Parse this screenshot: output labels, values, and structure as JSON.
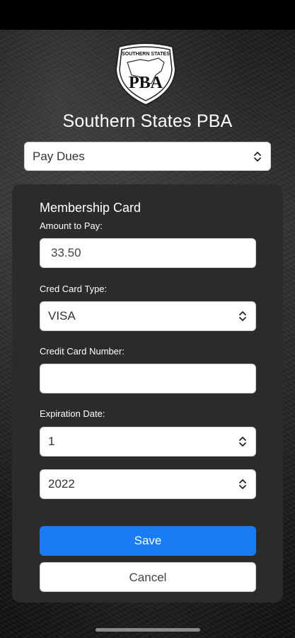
{
  "app": {
    "title": "Southern States PBA",
    "logo_top_text": "SOUTHERN STATES",
    "logo_letters": "PBA"
  },
  "nav_select": {
    "value": "Pay Dues"
  },
  "form": {
    "title": "Membership Card",
    "amount_label": "Amount to Pay:",
    "amount_value": "33.50",
    "card_type_label": "Cred Card Type:",
    "card_type_value": "VISA",
    "card_number_label": "Credit Card Number:",
    "card_number_value": "",
    "expiration_label": "Expiration Date:",
    "exp_month_value": "1",
    "exp_year_value": "2022",
    "save_label": "Save",
    "cancel_label": "Cancel"
  },
  "colors": {
    "primary_button": "#1a7cf5",
    "panel": "#2b2b2b",
    "text_light": "#ffffff"
  }
}
